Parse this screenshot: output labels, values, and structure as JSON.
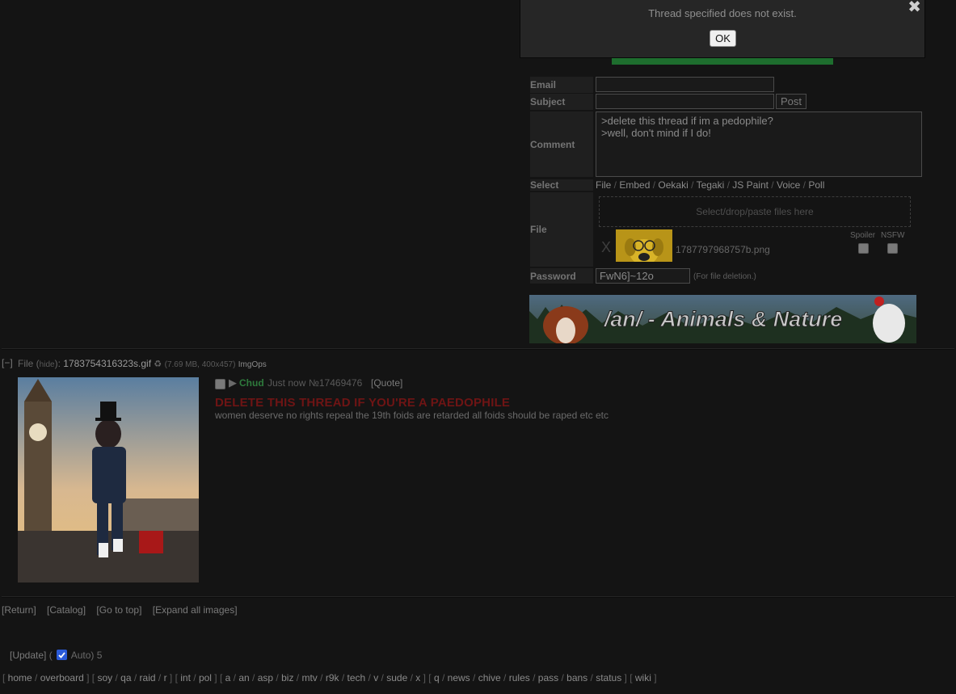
{
  "popup": {
    "message": "Thread specified does not exist.",
    "ok_label": "OK",
    "close_glyph": "✖"
  },
  "form": {
    "email_label": "Email",
    "subject_label": "Subject",
    "post_label": "Post",
    "comment_label": "Comment",
    "comment_value": ">delete this thread if im a pedophile?\n>well, don't mind if I do!",
    "select_label": "Select",
    "select_options": [
      "File",
      "Embed",
      "Oekaki",
      "Tegaki",
      "JS Paint",
      "Voice",
      "Poll"
    ],
    "file_label": "File",
    "dropzone_text": "Select/drop/paste files here",
    "remove_glyph": "X",
    "attached_file_name": "1787797968757b.png",
    "spoiler_label": "Spoiler",
    "nsfw_label": "NSFW",
    "password_label": "Password",
    "password_value": "FwN6]~12o",
    "password_note": "(For file deletion.)"
  },
  "banner": {
    "text": "/an/ - Animals & Nature"
  },
  "post": {
    "collapse_label": "[−]",
    "file_prefix": "File (",
    "hide_label": "hide",
    "file_suffix": "):",
    "file_name": "1783754316323s.gif",
    "file_meta": "(7.69 MB, 400x457)",
    "imgops_label": "ImgOps",
    "name": "Chud",
    "time": "Just now",
    "number": "№17469476",
    "quote_label": "[Quote]",
    "subject": "DELETE THIS THREAD IF YOU'RE A PAEDOPHILE",
    "body": "women deserve no rights repeal the 19th foids are retarded all foids should be raped etc etc"
  },
  "bottom_links": [
    "[Return]",
    "[Catalog]",
    "[Go to top]",
    "[Expand all images]"
  ],
  "update": {
    "update_label": "[Update]",
    "open_paren": "(",
    "auto_label": "Auto)",
    "count": "5"
  },
  "board_nav": [
    [
      "home",
      "overboard"
    ],
    [
      "soy",
      "qa",
      "raid",
      "r"
    ],
    [
      "int",
      "pol"
    ],
    [
      "a",
      "an",
      "asp",
      "biz",
      "mtv",
      "r9k",
      "tech",
      "v",
      "sude",
      "x"
    ],
    [
      "q",
      "news",
      "chive",
      "rules",
      "pass",
      "bans",
      "status"
    ],
    [
      "wiki"
    ]
  ],
  "colors": {
    "accent_green": "#2e7a3c",
    "subject_red": "#6e1414",
    "checkbox_blue": "#2a5ad8"
  }
}
